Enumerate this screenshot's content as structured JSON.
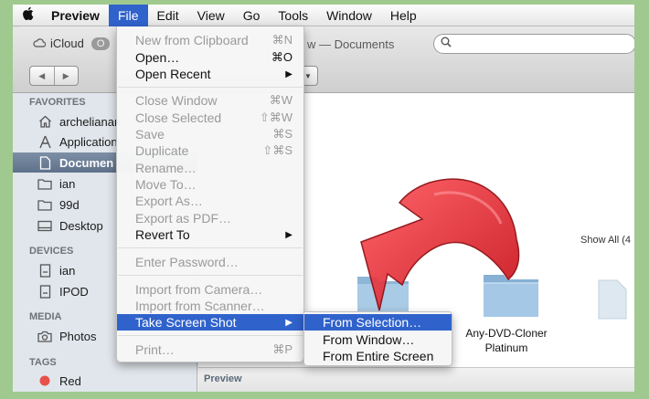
{
  "menubar": {
    "apple_icon": "apple-logo",
    "app_name": "Preview",
    "items": [
      "File",
      "Edit",
      "View",
      "Go",
      "Tools",
      "Window",
      "Help"
    ],
    "active_item": "File"
  },
  "toolbar": {
    "icloud_label": "iCloud",
    "title_fragment": "w — Documents",
    "search_icon": "search-icon"
  },
  "sidebar": {
    "favorites_heading": "FAVORITES",
    "favorites": [
      {
        "label": "archelianan",
        "icon": "home-icon"
      },
      {
        "label": "Application",
        "icon": "applications-icon"
      },
      {
        "label": "Documen",
        "icon": "documents-icon",
        "selected": true
      },
      {
        "label": "ian",
        "icon": "folder-icon"
      },
      {
        "label": "99d",
        "icon": "folder-icon"
      },
      {
        "label": "Desktop",
        "icon": "desktop-icon"
      }
    ],
    "devices_heading": "DEVICES",
    "devices": [
      {
        "label": "ian",
        "icon": "disk-icon"
      },
      {
        "label": "IPOD",
        "icon": "disk-icon"
      }
    ],
    "media_heading": "MEDIA",
    "media": [
      {
        "label": "Photos",
        "icon": "camera-icon"
      }
    ],
    "tags_heading": "TAGS",
    "tags": [
      {
        "label": "Red",
        "color": "#e8514a"
      }
    ]
  },
  "content": {
    "show_all": "Show All (4",
    "folder_label": "Any-DVD-Cloner Platinum",
    "preview_label": "Preview"
  },
  "file_menu": {
    "new_from_clipboard": {
      "label": "New from Clipboard",
      "shortcut": "⌘N"
    },
    "open": {
      "label": "Open…",
      "shortcut": "⌘O"
    },
    "open_recent": {
      "label": "Open Recent"
    },
    "close_window": {
      "label": "Close Window",
      "shortcut": "⌘W"
    },
    "close_selected": {
      "label": "Close Selected",
      "shortcut": "⇧⌘W"
    },
    "save": {
      "label": "Save",
      "shortcut": "⌘S"
    },
    "duplicate": {
      "label": "Duplicate",
      "shortcut": "⇧⌘S"
    },
    "rename": {
      "label": "Rename…"
    },
    "move_to": {
      "label": "Move To…"
    },
    "export_as": {
      "label": "Export As…"
    },
    "export_pdf": {
      "label": "Export as PDF…"
    },
    "revert_to": {
      "label": "Revert To"
    },
    "enter_password": {
      "label": "Enter Password…"
    },
    "import_camera": {
      "label": "Import from Camera…"
    },
    "import_scanner": {
      "label": "Import from Scanner…"
    },
    "take_screen_shot": {
      "label": "Take Screen Shot"
    },
    "print": {
      "label": "Print…",
      "shortcut": "⌘P"
    }
  },
  "screenshot_submenu": {
    "from_selection": "From Selection…",
    "from_window": "From Window…",
    "from_entire_screen": "From Entire Screen"
  },
  "colors": {
    "highlight": "#3062cc",
    "annotation_arrow": "#e8202a",
    "background_border": "#9fc98f"
  }
}
